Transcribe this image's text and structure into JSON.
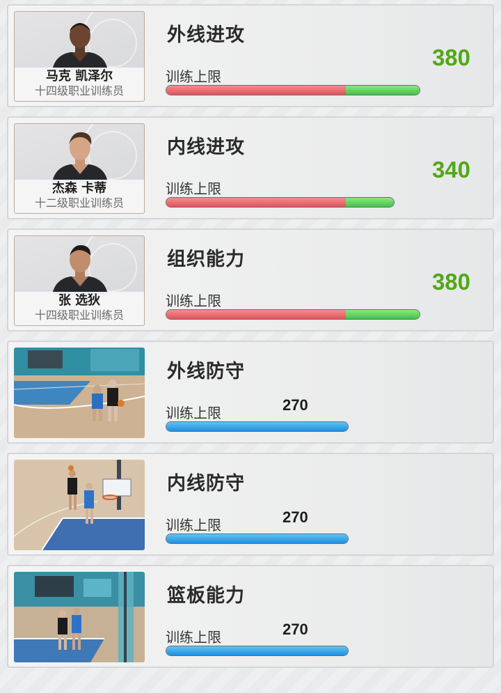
{
  "training_limit_label": "训练上限",
  "colors": {
    "score_green": "#52a818",
    "bar_red": "#e0545a",
    "bar_green": "#44c04a",
    "bar_blue": "#1f8fe0"
  },
  "cards": [
    {
      "title": "外线进攻",
      "coach_name": "马克 凯泽尔",
      "coach_rank": "十四级职业训练员",
      "score": "380",
      "icon": "coach-portrait",
      "bar": {
        "base_fraction": 0.71,
        "bonus_fraction": 0.29,
        "scale_max": 380
      }
    },
    {
      "title": "内线进攻",
      "coach_name": "杰森 卡蒂",
      "coach_rank": "十二级职业训练员",
      "score": "340",
      "icon": "coach-portrait",
      "bar": {
        "base_fraction": 0.79,
        "bonus_fraction": 0.21
      }
    },
    {
      "title": "组织能力",
      "coach_name": "张 选狄",
      "coach_rank": "十四级职业训练员",
      "score": "380",
      "icon": "coach-portrait",
      "bar": {
        "base_fraction": 0.71,
        "bonus_fraction": 0.29
      }
    },
    {
      "title": "外线防守",
      "limit": "270",
      "icon": "perimeter-defense-scene",
      "bar": {
        "fill_fraction": 1.0
      }
    },
    {
      "title": "内线防守",
      "limit": "270",
      "icon": "interior-defense-scene",
      "bar": {
        "fill_fraction": 1.0
      }
    },
    {
      "title": "篮板能力",
      "limit": "270",
      "icon": "rebound-scene",
      "bar": {
        "fill_fraction": 1.0
      }
    }
  ]
}
